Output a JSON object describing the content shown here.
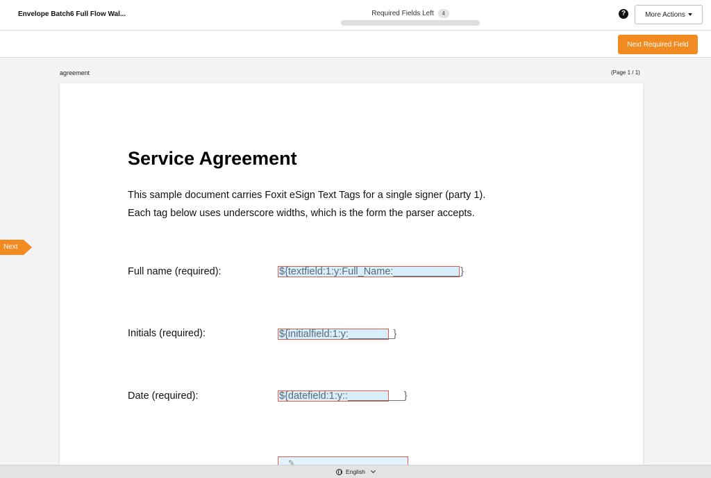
{
  "header": {
    "envelope_title": "Envelope Batch6 Full Flow Wal...",
    "required_label": "Required Fields Left",
    "required_count": "4",
    "progress_fraction": 0,
    "more_actions_label": "More Actions",
    "help_glyph": "?"
  },
  "toolbar": {
    "next_required_label": "Next Required Field"
  },
  "document": {
    "name": "agreement",
    "page_indicator": "(Page 1 / 1)",
    "heading": "Service Agreement",
    "paragraph_1": "This sample document carries Foxit eSign Text Tags for a single signer (party 1).",
    "paragraph_2": "Each tag below uses underscore widths, which is the form the parser accepts.",
    "fields": [
      {
        "label": "Full name (required):",
        "tag": "${textfield:1:y:Full_Name:____________}"
      },
      {
        "label": "Initials (required):",
        "tag": "${initialfield:1:y:________}"
      },
      {
        "label": "Date (required):",
        "tag": "${datefield:1:y::__________}"
      }
    ]
  },
  "nav": {
    "next_flag_label": "Next",
    "accent_color": "#f28a22"
  },
  "footer": {
    "language": "English"
  },
  "icons": {
    "help": "help-icon",
    "caret": "caret-down-icon",
    "globe": "globe-icon",
    "chevron": "chevron-down-icon",
    "pen": "pen-icon"
  }
}
